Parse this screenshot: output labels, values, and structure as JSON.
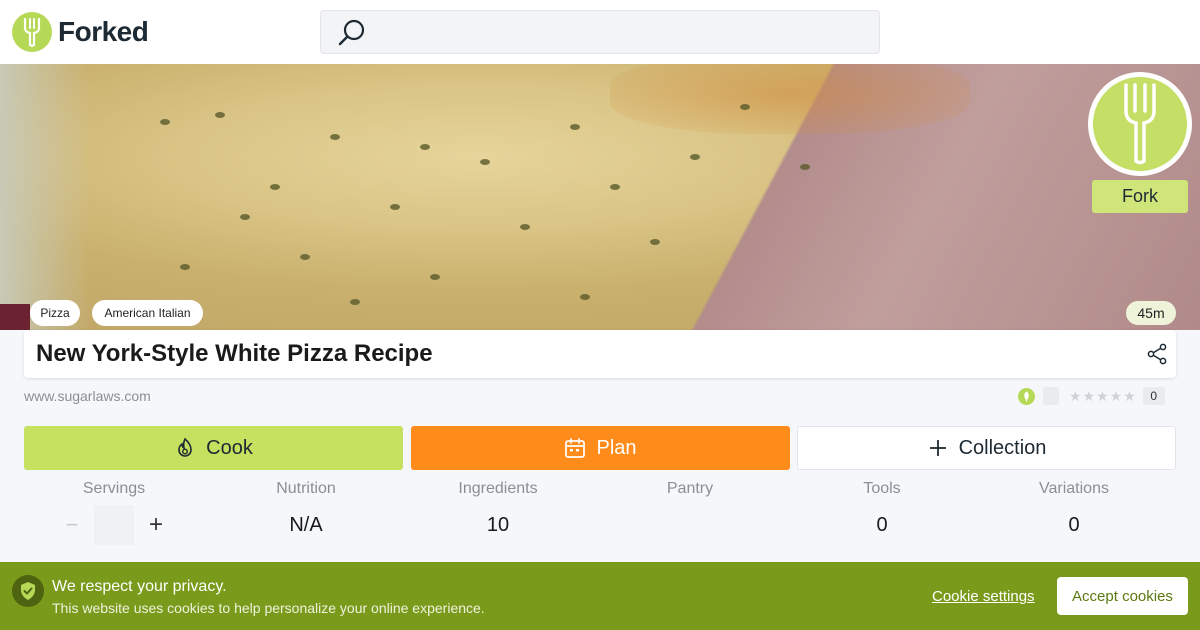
{
  "header": {
    "logo_text": "Forked",
    "search": {
      "placeholder": "",
      "icon": "search-icon"
    }
  },
  "hero": {
    "tags": [
      "Pizza",
      "American Italian"
    ],
    "time": "45m",
    "fork_button_label": "Fork"
  },
  "recipe": {
    "title": "New York-Style White Pizza Recipe",
    "source": "www.sugarlaws.com",
    "rating_count": "0",
    "stars": "★★★★★"
  },
  "actions": {
    "cook": "Cook",
    "plan": "Plan",
    "collection": "Collection"
  },
  "stats": [
    {
      "label": "Servings",
      "value": ""
    },
    {
      "label": "Nutrition",
      "value": "N/A"
    },
    {
      "label": "Ingredients",
      "value": "10"
    },
    {
      "label": "Pantry",
      "value": ""
    },
    {
      "label": "Tools",
      "value": "0"
    },
    {
      "label": "Variations",
      "value": "0"
    }
  ],
  "servings_controls": {
    "minus": "−",
    "plus": "+"
  },
  "cookie_banner": {
    "title": "We respect your privacy.",
    "text": "This website uses cookies to help personalize your online experience.",
    "settings_label": "Cookie settings",
    "accept_label": "Accept cookies"
  },
  "colors": {
    "brand_green": "#b5d957",
    "plan_orange": "#ff8c1a",
    "cookie_bar": "#7a9a1c"
  }
}
